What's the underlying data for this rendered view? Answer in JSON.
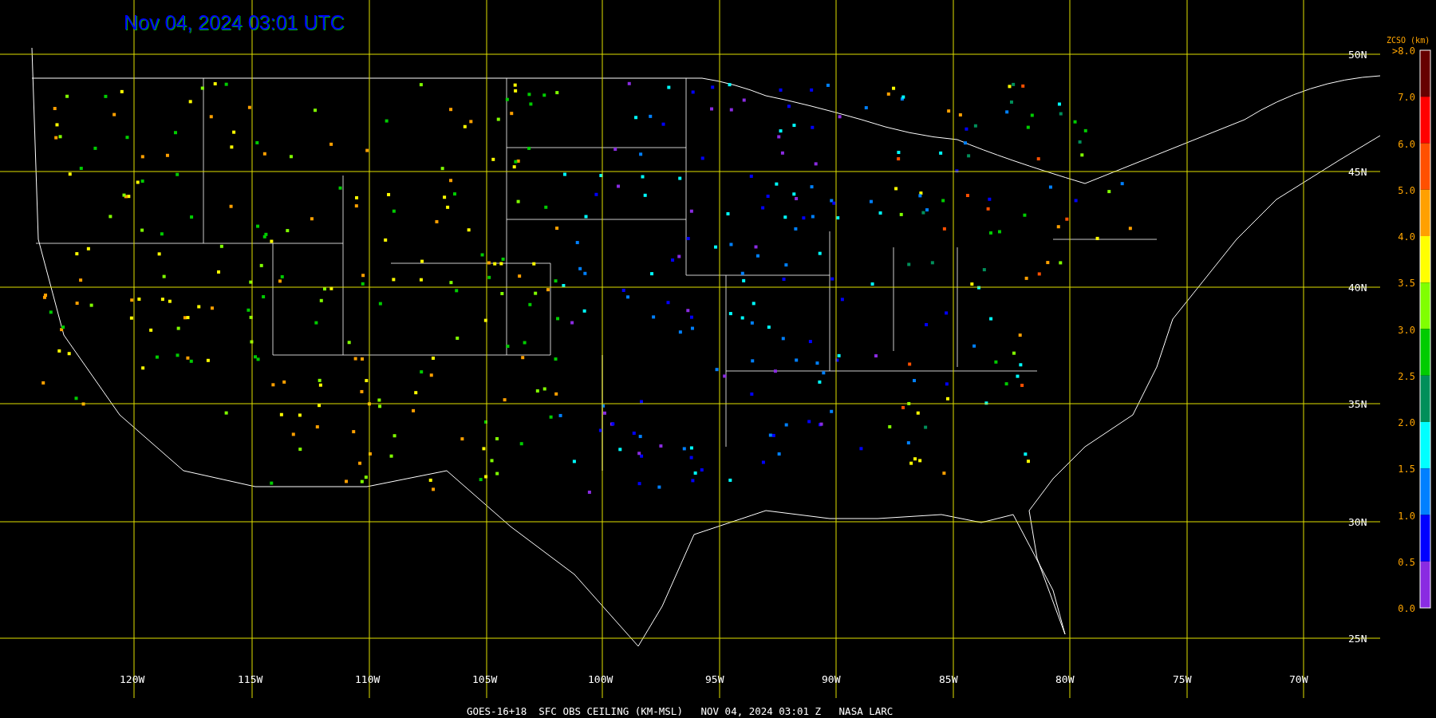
{
  "title": "Nov 04, 2024 03:01 UTC",
  "lat_labels": [
    "50N",
    "45N",
    "40N",
    "35N",
    "30N",
    "25N"
  ],
  "lon_labels": [
    "120W",
    "115W",
    "110W",
    "105W",
    "100W",
    "95W",
    "90W",
    "85W",
    "80W",
    "75W",
    "70W"
  ],
  "colorbar": {
    "title": "ZCSO (km)",
    "labels": [
      ">8.0",
      "7.0",
      "6.0",
      "5.0",
      "4.0",
      "3.5",
      "3.0",
      "2.5",
      "2.0",
      "1.5",
      "1.0",
      "0.5",
      "0.0"
    ],
    "segments": [
      {
        "color": "#660000"
      },
      {
        "color": "#ff0000"
      },
      {
        "color": "#ff5000"
      },
      {
        "color": "#ffa000"
      },
      {
        "color": "#ffff00"
      },
      {
        "color": "#80ff00"
      },
      {
        "color": "#00cc00"
      },
      {
        "color": "#008f5a"
      },
      {
        "color": "#00ffff"
      },
      {
        "color": "#0080ff"
      },
      {
        "color": "#0000ff"
      },
      {
        "color": "#8a2be2"
      }
    ]
  },
  "footer": "GOES-16+18  SFC OBS CEILING (KM-MSL)   NOV 04, 2024 03:01 Z   NASA LARC"
}
